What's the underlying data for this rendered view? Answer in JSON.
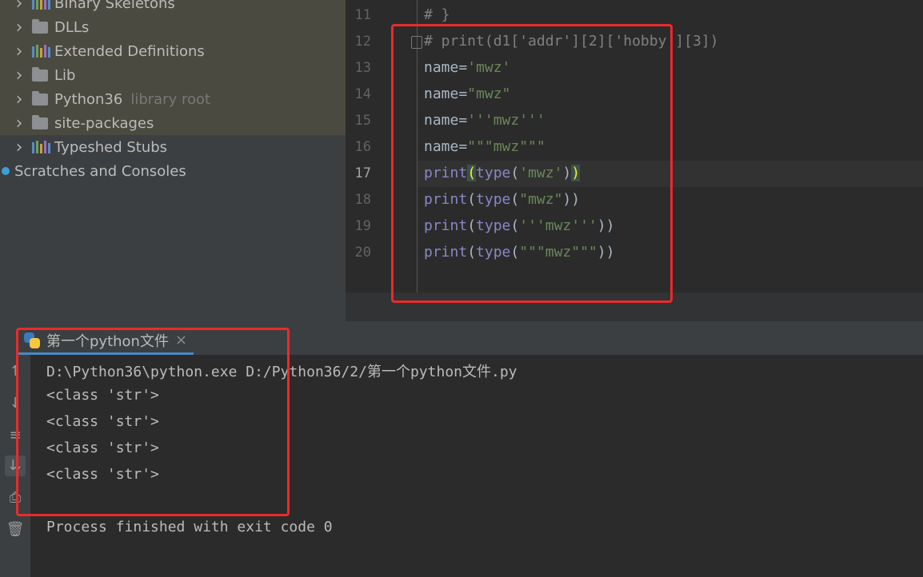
{
  "tree": {
    "items": [
      {
        "label": "Binary Skeletons",
        "icon": "library-icon"
      },
      {
        "label": "DLLs",
        "icon": "folder-icon"
      },
      {
        "label": "Extended Definitions",
        "icon": "library-icon"
      },
      {
        "label": "Lib",
        "icon": "folder-icon"
      },
      {
        "label": "Python36",
        "secondary": "library root",
        "icon": "folder-icon"
      },
      {
        "label": "site-packages",
        "icon": "folder-icon"
      },
      {
        "label": "Typeshed Stubs",
        "icon": "library-icon"
      }
    ],
    "scratches": "Scratches and Consoles"
  },
  "editor": {
    "line_numbers": [
      "11",
      "12",
      "13",
      "14",
      "15",
      "16",
      "17",
      "18",
      "19",
      "20"
    ],
    "current_line": "17",
    "lines": [
      [
        {
          "t": "# }",
          "c": "cmt"
        }
      ],
      [
        {
          "t": "# print(d1['addr'][2]['hobby'][3])",
          "c": "cmt"
        }
      ],
      [
        {
          "t": "name=",
          "c": ""
        },
        {
          "t": "'mwz'",
          "c": "str"
        }
      ],
      [
        {
          "t": "name=",
          "c": ""
        },
        {
          "t": "\"mwz\"",
          "c": "str"
        }
      ],
      [
        {
          "t": "name=",
          "c": ""
        },
        {
          "t": "'''mwz'''",
          "c": "str"
        }
      ],
      [
        {
          "t": "name=",
          "c": ""
        },
        {
          "t": "\"\"\"mwz\"\"\"",
          "c": "str"
        }
      ],
      [
        {
          "t": "print",
          "c": "kw"
        },
        {
          "t": "(",
          "c": "paren-hl"
        },
        {
          "t": "type",
          "c": "kw"
        },
        {
          "t": "(",
          "c": ""
        },
        {
          "t": "'mwz'",
          "c": "str"
        },
        {
          "t": ")",
          "c": ""
        },
        {
          "t": ")",
          "c": "paren-hl"
        }
      ],
      [
        {
          "t": "print",
          "c": "kw"
        },
        {
          "t": "(",
          "c": ""
        },
        {
          "t": "type",
          "c": "kw"
        },
        {
          "t": "(",
          "c": ""
        },
        {
          "t": "\"mwz\"",
          "c": "str"
        },
        {
          "t": "))",
          "c": ""
        }
      ],
      [
        {
          "t": "print",
          "c": "kw"
        },
        {
          "t": "(",
          "c": ""
        },
        {
          "t": "type",
          "c": "kw"
        },
        {
          "t": "(",
          "c": ""
        },
        {
          "t": "'''mwz'''",
          "c": "str"
        },
        {
          "t": "))",
          "c": ""
        }
      ],
      [
        {
          "t": "print",
          "c": "kw"
        },
        {
          "t": "(",
          "c": ""
        },
        {
          "t": "type",
          "c": "kw"
        },
        {
          "t": "(",
          "c": ""
        },
        {
          "t": "\"\"\"mwz\"\"\"",
          "c": "str"
        },
        {
          "t": "))",
          "c": ""
        }
      ]
    ]
  },
  "run": {
    "tab_label": "第一个python文件",
    "output": [
      "D:\\Python36\\python.exe D:/Python36/2/第一个python文件.py",
      "<class 'str'>",
      "<class 'str'>",
      "<class 'str'>",
      "<class 'str'>",
      "",
      "Process finished with exit code 0"
    ]
  },
  "colors": {
    "highlight_box": "#ec2a2a",
    "keyword": "#8888c6",
    "string": "#6a8759",
    "comment": "#808080"
  }
}
